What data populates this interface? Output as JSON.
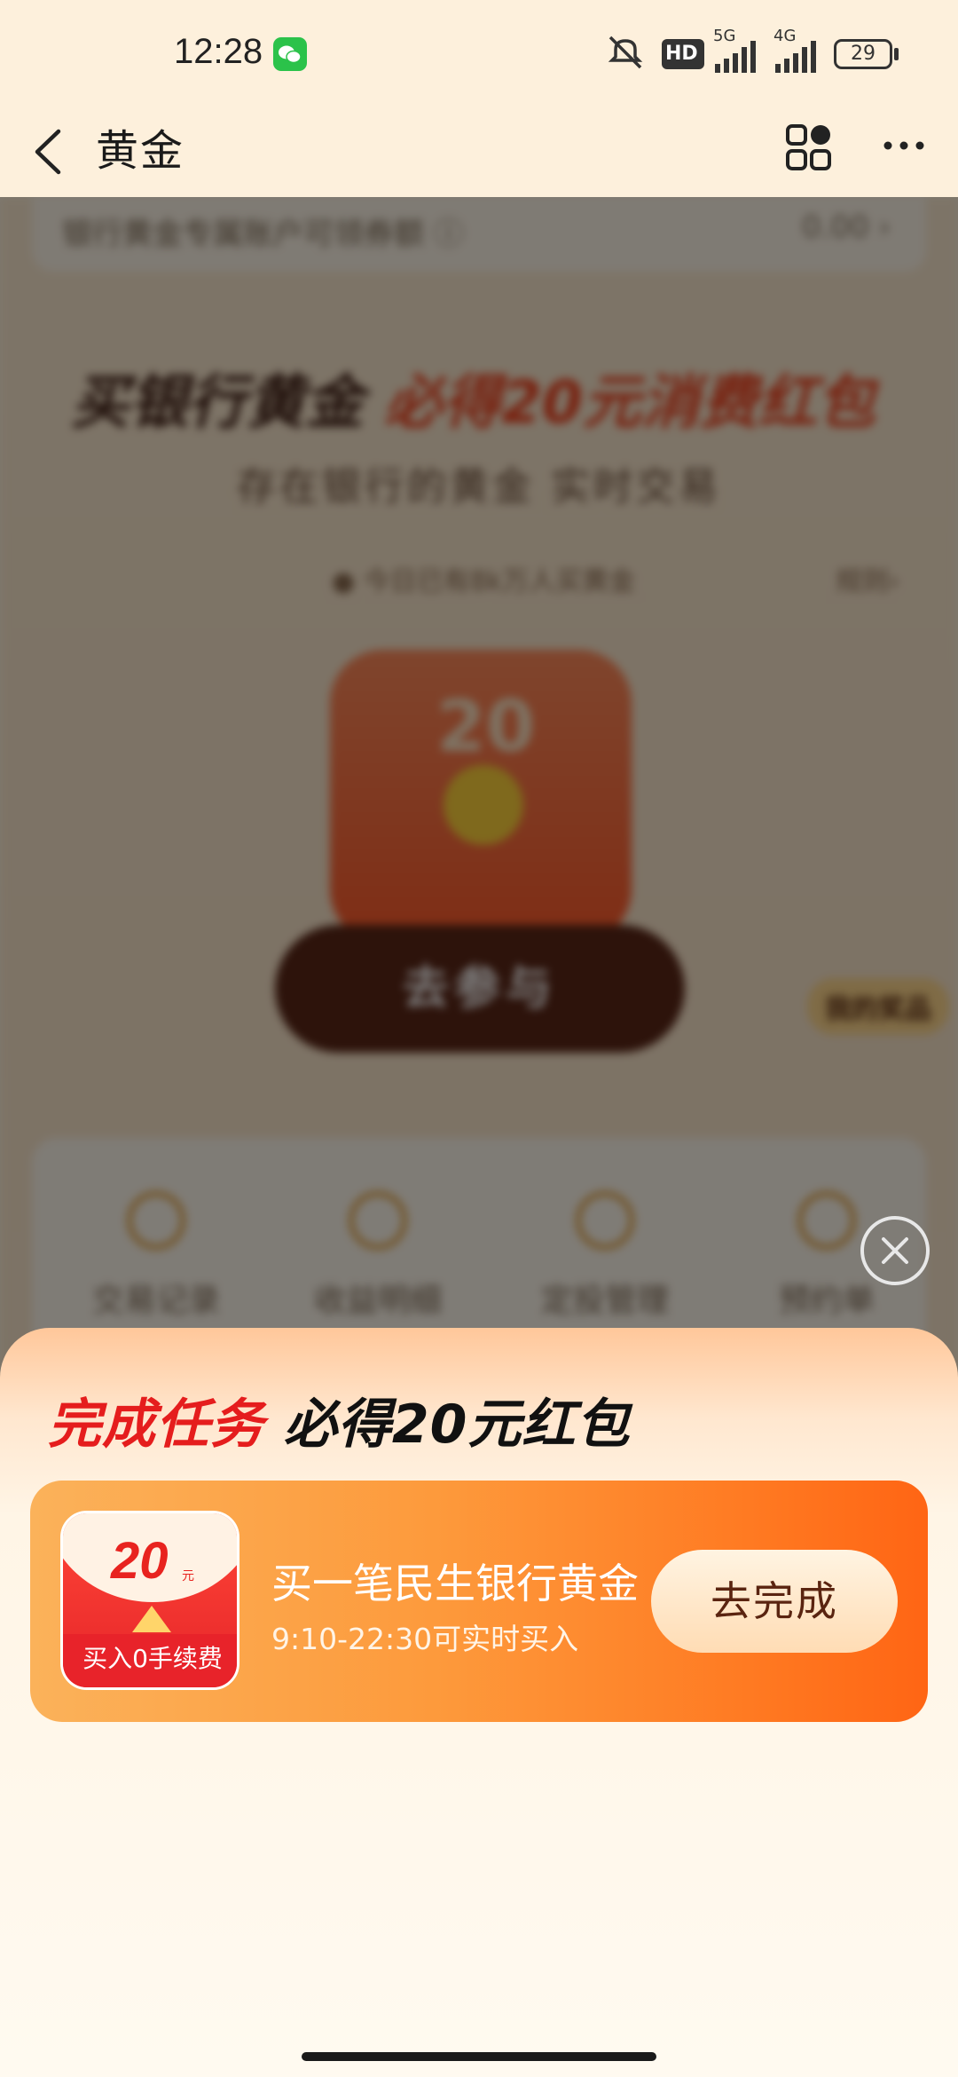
{
  "status_bar": {
    "time": "12:28",
    "network_5g": "5G",
    "network_4g": "4G",
    "hd_label": "HD",
    "battery": "29"
  },
  "header": {
    "title": "黄金"
  },
  "background": {
    "notice_text": "银行黄金专属账户可领券额 ⓘ",
    "notice_right": "0.00 ›",
    "banner_title_part1": "买银行黄金 ",
    "banner_title_part2": "必得20元消费红包",
    "banner_subtitle": "存在银行的黄金 实时交易",
    "banner_line": "● 今日已有8k万人买黄金",
    "banner_rule": "规则›",
    "packet_amount": "20",
    "cta_label": "去参与",
    "side_tag": "我的奖品",
    "shortcuts": [
      {
        "label": "交易记录"
      },
      {
        "label": "收益明细"
      },
      {
        "label": "定投管理"
      },
      {
        "label": "预约单"
      }
    ]
  },
  "sheet": {
    "title_red": "完成任务",
    "title_dark": " 必得20元红包",
    "task": {
      "thumb_amount": "20",
      "thumb_unit": "元",
      "thumb_badge": "买入0手续费",
      "title": "买一笔民生银行黄金",
      "subtitle": "9:10-22:30可实时买入",
      "button_label": "去完成"
    }
  },
  "colors": {
    "accent_red": "#e51d1d",
    "card_orange": "#ff7a22",
    "button_text": "#5a2410"
  }
}
